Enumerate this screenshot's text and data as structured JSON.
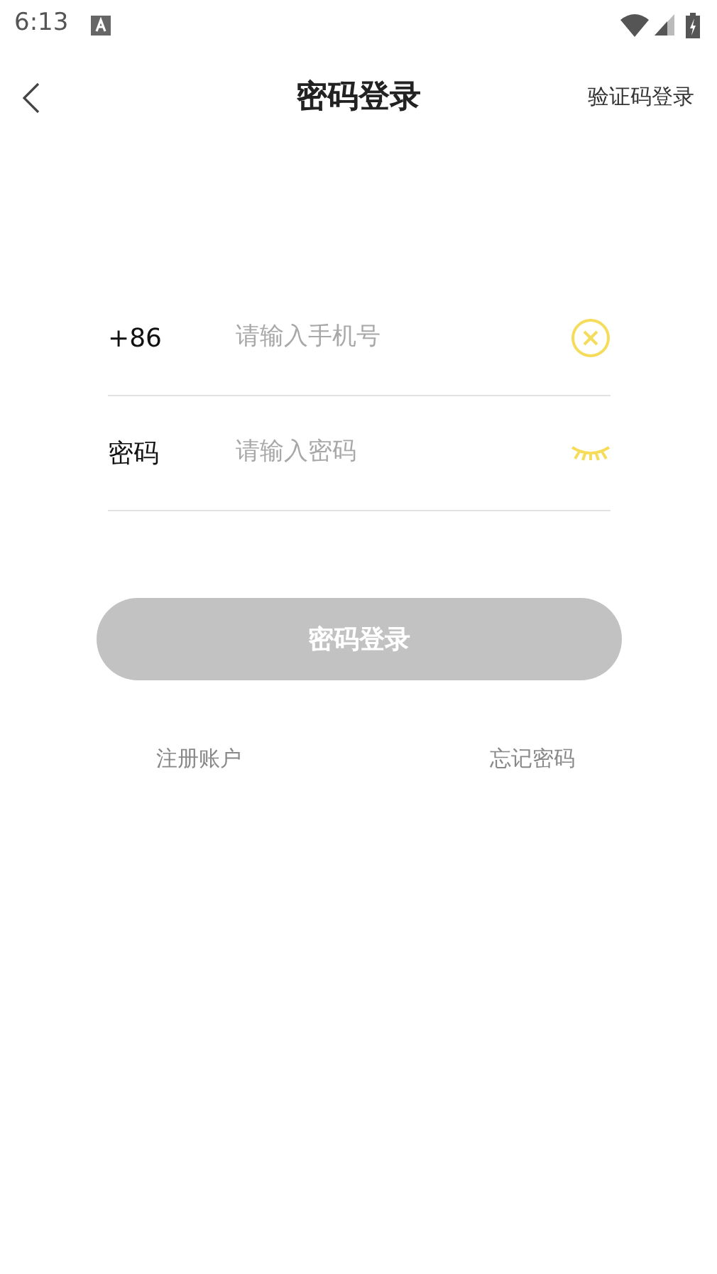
{
  "status_bar": {
    "time": "6:13"
  },
  "header": {
    "title": "密码登录",
    "action": "验证码登录"
  },
  "fields": [
    {
      "kind": "phone",
      "label": "+86",
      "placeholder": "请输入手机号"
    },
    {
      "kind": "password",
      "label": "密码",
      "placeholder": "请输入密码"
    }
  ],
  "login_button": {
    "label": "密码登录",
    "disabled": true
  },
  "links": [
    "注册账户",
    "忘记密码"
  ]
}
